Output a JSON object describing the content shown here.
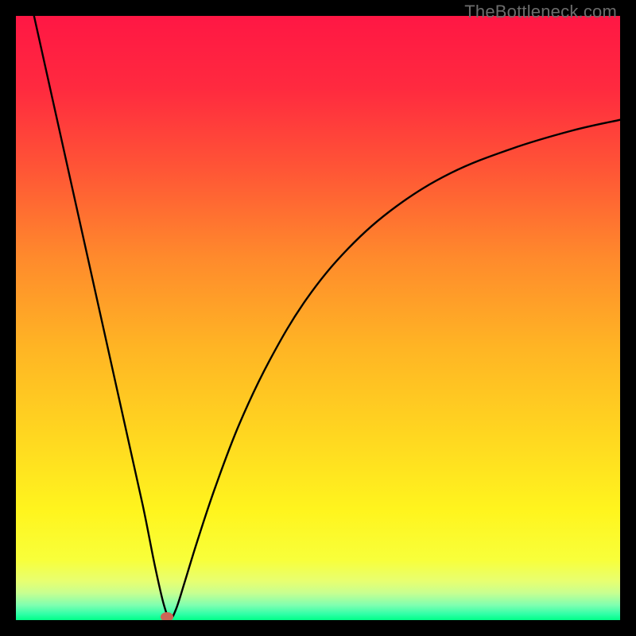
{
  "watermark": "TheBottleneck.com",
  "chart_data": {
    "type": "line",
    "title": "",
    "xlabel": "",
    "ylabel": "",
    "xlim": [
      0,
      100
    ],
    "ylim": [
      0,
      100
    ],
    "grid": false,
    "legend": false,
    "background_gradient": {
      "stops": [
        {
          "pos": 0.0,
          "color": "#ff1744"
        },
        {
          "pos": 0.12,
          "color": "#ff2a3f"
        },
        {
          "pos": 0.25,
          "color": "#ff5436"
        },
        {
          "pos": 0.4,
          "color": "#ff8a2c"
        },
        {
          "pos": 0.55,
          "color": "#ffb524"
        },
        {
          "pos": 0.7,
          "color": "#ffd820"
        },
        {
          "pos": 0.82,
          "color": "#fff51e"
        },
        {
          "pos": 0.9,
          "color": "#f8ff3a"
        },
        {
          "pos": 0.935,
          "color": "#e8ff70"
        },
        {
          "pos": 0.955,
          "color": "#c8ff90"
        },
        {
          "pos": 0.975,
          "color": "#80ffb0"
        },
        {
          "pos": 0.99,
          "color": "#30ffa8"
        },
        {
          "pos": 1.0,
          "color": "#00ff88"
        }
      ]
    },
    "series": [
      {
        "name": "bottleneck-curve",
        "x": [
          3.0,
          6.0,
          9.0,
          12.0,
          15.0,
          18.0,
          21.0,
          23.0,
          24.5,
          25.5,
          26.5,
          28.0,
          30.0,
          33.0,
          37.0,
          42.0,
          48.0,
          55.0,
          63.0,
          72.0,
          82.0,
          92.0,
          100.0
        ],
        "values": [
          100.0,
          86.5,
          73.0,
          59.5,
          46.0,
          32.5,
          19.0,
          9.0,
          2.5,
          0.3,
          1.8,
          6.5,
          13.0,
          22.0,
          32.5,
          43.0,
          53.0,
          61.5,
          68.5,
          74.0,
          78.0,
          81.0,
          82.8
        ]
      }
    ],
    "markers": [
      {
        "name": "optimum-point",
        "x": 25.0,
        "y": 0.5,
        "w": 2.2,
        "h": 1.6,
        "color": "#cc6655"
      }
    ]
  }
}
